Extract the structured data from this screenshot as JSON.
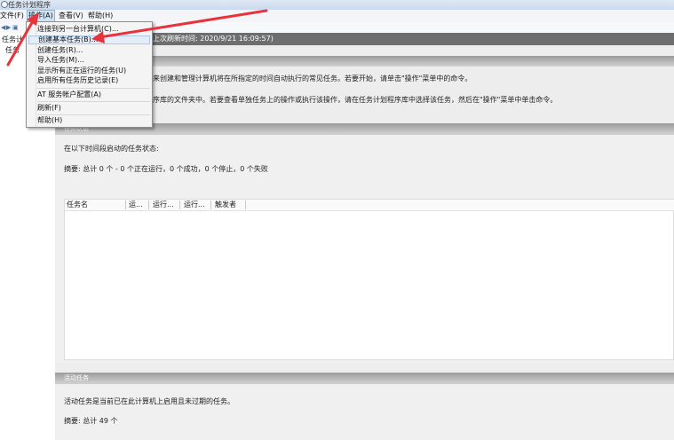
{
  "window": {
    "title": "任务计划程序"
  },
  "menubar": {
    "file": "文件(F)",
    "action": "操作(A)",
    "view": "查看(V)",
    "help": "帮助(H)"
  },
  "tree": {
    "items": [
      {
        "label": "任务计"
      },
      {
        "label": "任务"
      }
    ]
  },
  "main": {
    "header": "上次刷新时间: 2020/9/21 16:09:57)",
    "intro_line1": "来创建和管理计算机将在所指定的时间自动执行的常见任务。若要开始，请单击\"操作\"菜单中的命令。",
    "intro_line2": "序库的文件夹中。若要查看单独任务上的操作或执行该操作，请在任务计划程序库中选择该任务，然后在\"操作\"菜单中单击命令。",
    "task_status": {
      "section_title": "任务状态",
      "prompt": "在以下时间段启动的任务状态:",
      "summary": "摘要: 总计 0 个 - 0 个正在运行，0 个成功，0 个停止，0 个失败",
      "columns": [
        "任务名",
        "运...",
        "运行...",
        "运行...",
        "触发者"
      ]
    },
    "active_tasks": {
      "section_title": "活动任务",
      "description": "活动任务是当前已在此计算机上启用且未过期的任务。",
      "summary": "摘要: 总计 49 个"
    }
  },
  "dropdown": {
    "items": [
      {
        "label": "连接到另一台计算机(C)..."
      },
      {
        "label": "创建基本任务(B)..."
      },
      {
        "label": "创建任务(R)..."
      },
      {
        "label": "导入任务(M)..."
      },
      {
        "label": "显示所有正在运行的任务(U)"
      },
      {
        "label": "启用所有任务历史记录(E)"
      },
      {
        "label": "AT 服务帐户配置(A)"
      },
      {
        "label": "刷新(F)"
      },
      {
        "label": "帮助(H)"
      }
    ]
  },
  "colors": {
    "annotation_arrow": "#e8323c",
    "header_bar": "#6e6e6e",
    "menu_highlight": "#cfe4f7"
  }
}
